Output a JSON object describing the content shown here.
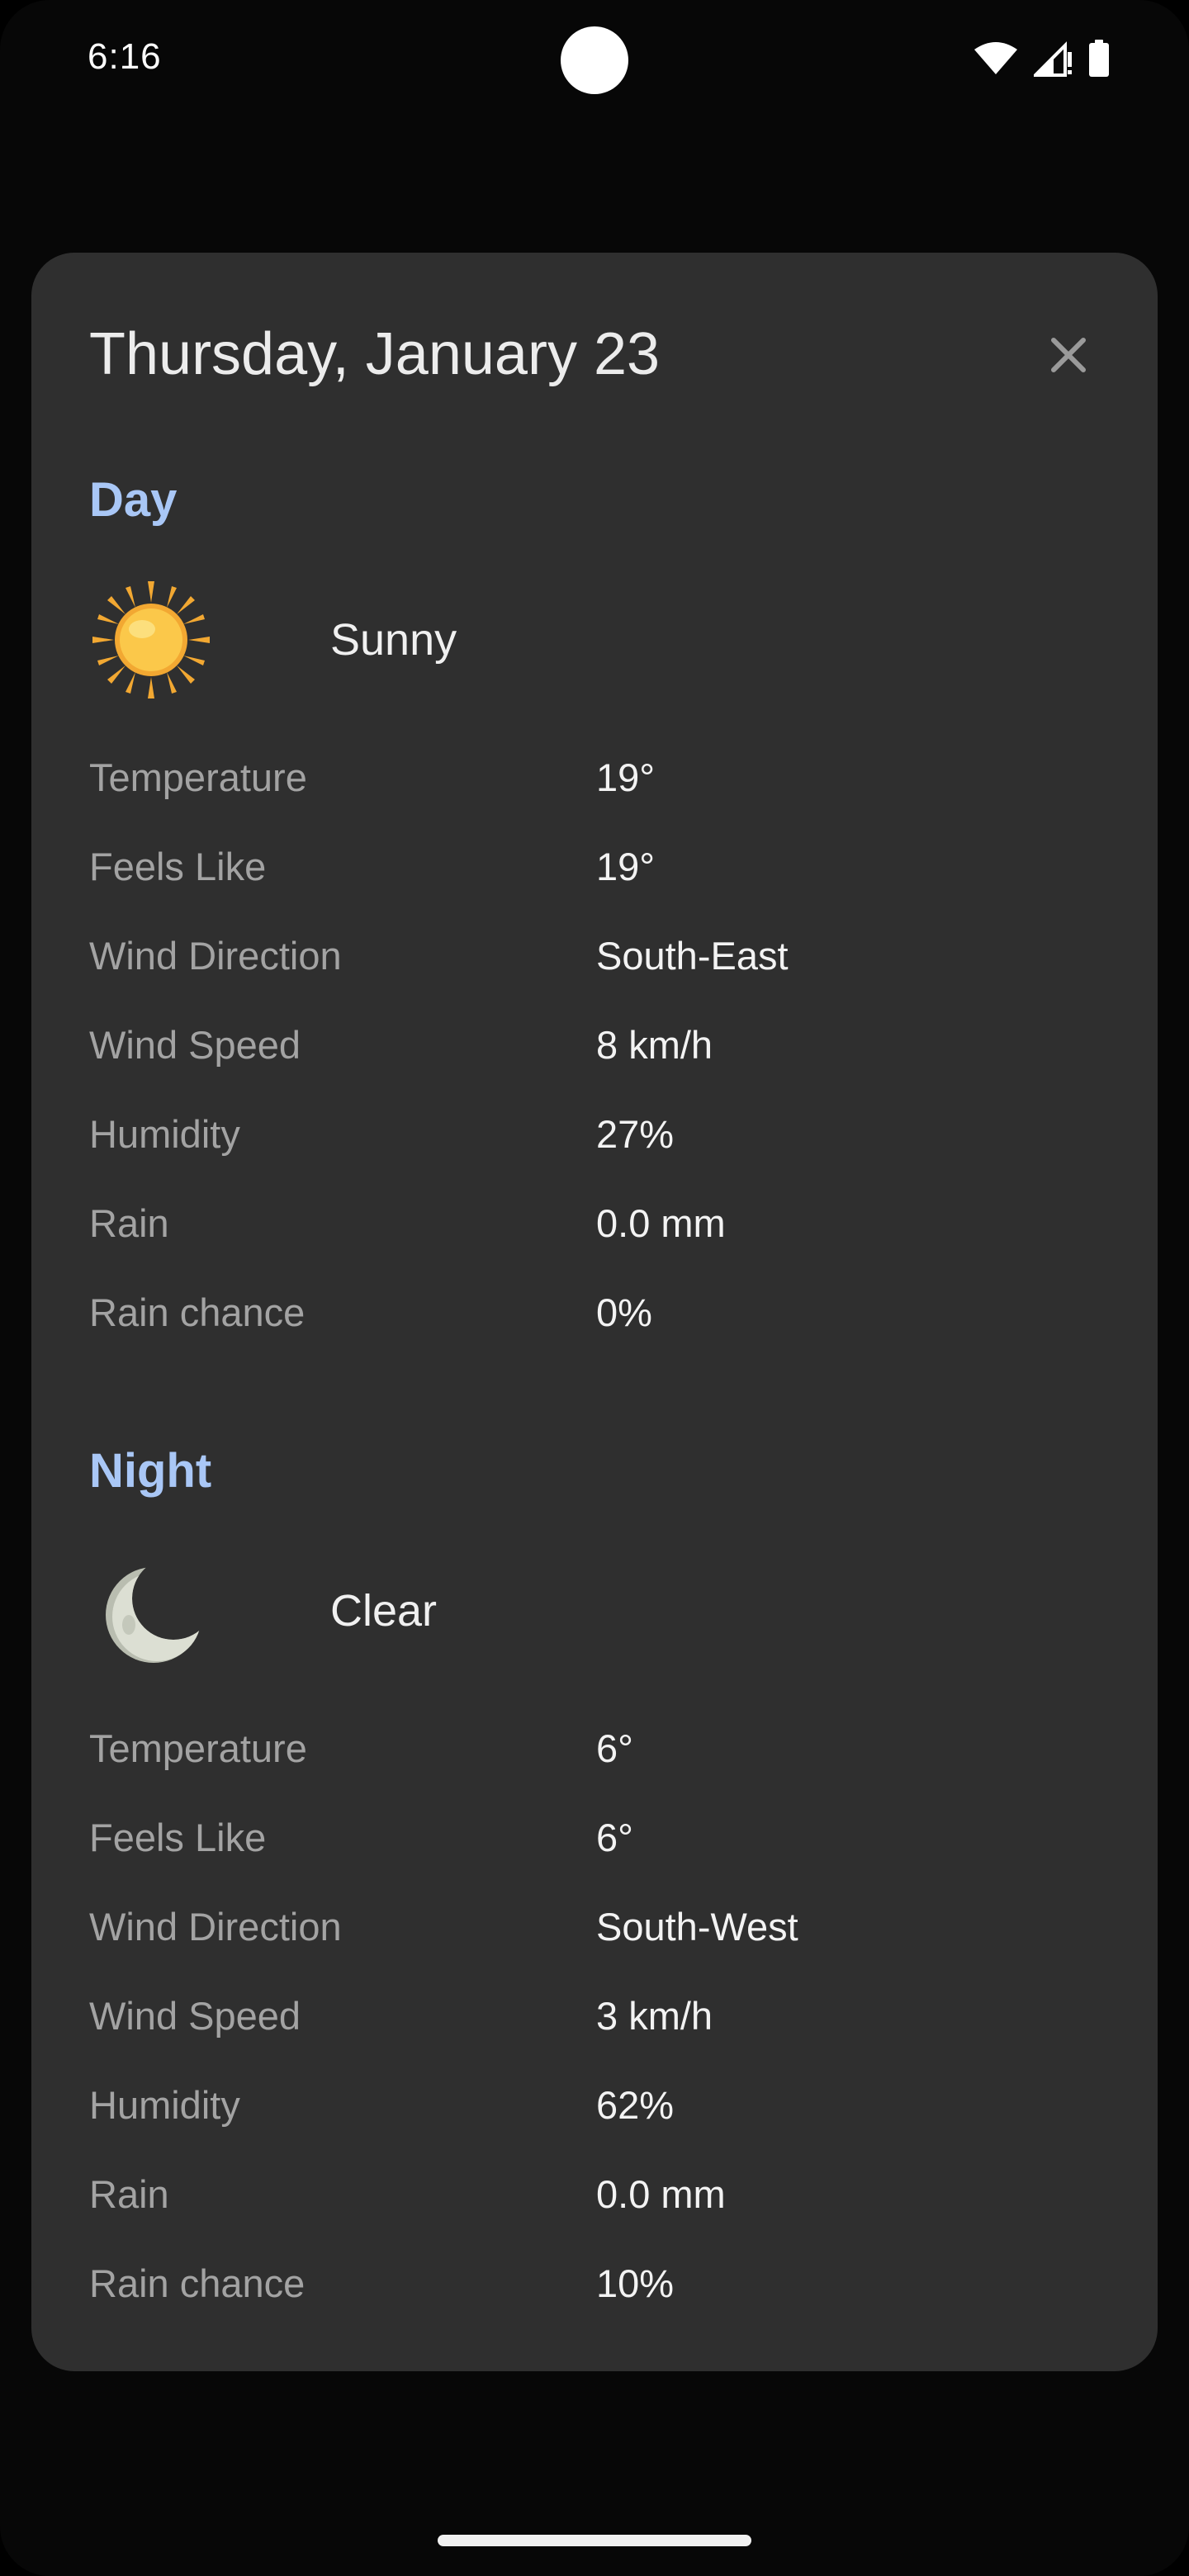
{
  "status_bar": {
    "time": "6:16",
    "icons": [
      "wifi-icon",
      "signal-icon",
      "battery-icon"
    ]
  },
  "dialog": {
    "title": "Thursday, January 23",
    "close_icon": "close-icon"
  },
  "day": {
    "label": "Day",
    "icon": "sun-icon",
    "condition": "Sunny",
    "rows": [
      {
        "label": "Temperature",
        "value": "19°"
      },
      {
        "label": "Feels Like",
        "value": "19°"
      },
      {
        "label": "Wind Direction",
        "value": "South-East"
      },
      {
        "label": "Wind Speed",
        "value": "8 km/h"
      },
      {
        "label": "Humidity",
        "value": "27%"
      },
      {
        "label": "Rain",
        "value": "0.0 mm"
      },
      {
        "label": "Rain chance",
        "value": "0%"
      }
    ]
  },
  "night": {
    "label": "Night",
    "icon": "moon-icon",
    "condition": "Clear",
    "rows": [
      {
        "label": "Temperature",
        "value": "6°"
      },
      {
        "label": "Feels Like",
        "value": "6°"
      },
      {
        "label": "Wind Direction",
        "value": "South-West"
      },
      {
        "label": "Wind Speed",
        "value": "3 km/h"
      },
      {
        "label": "Humidity",
        "value": "62%"
      },
      {
        "label": "Rain",
        "value": "0.0 mm"
      },
      {
        "label": "Rain chance",
        "value": "10%"
      }
    ]
  },
  "colors": {
    "section_accent": "#a9c7f6",
    "dialog_background": "#2f2f2f",
    "label_text": "#a3a3a3"
  }
}
